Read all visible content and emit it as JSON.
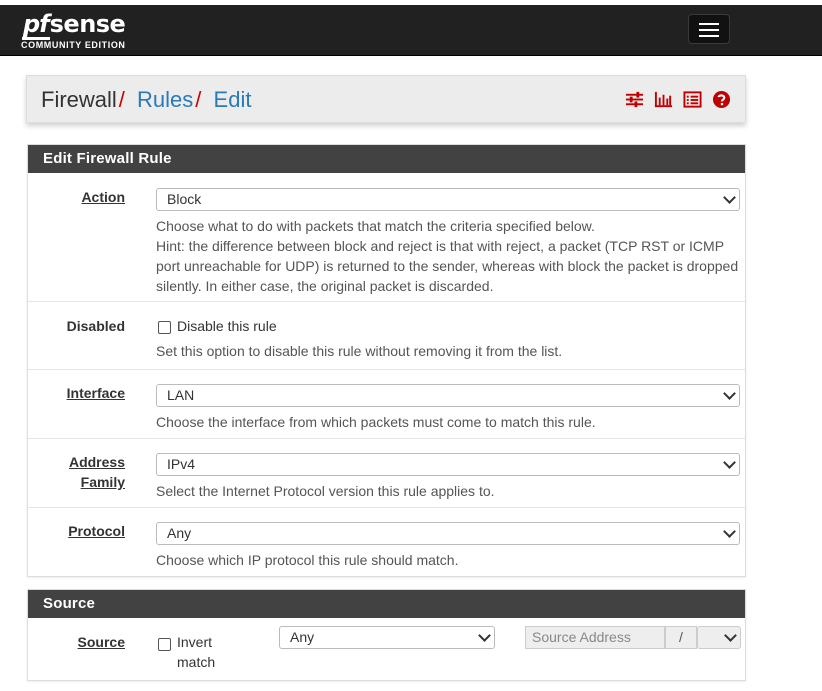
{
  "header": {
    "logo_pf": "pf",
    "logo_sense": "sense",
    "logo_edition": "COMMUNITY EDITION"
  },
  "breadcrumb": {
    "root": "Firewall",
    "sep1": "/",
    "link1": "Rules",
    "sep2": "/",
    "link2": "Edit"
  },
  "breadcrumb_icons": [
    "sliders-icon",
    "bar-chart-icon",
    "list-icon",
    "help-icon"
  ],
  "colors": {
    "navbar": "#212121",
    "panel_header": "#424242",
    "accent_red": "#c00000",
    "link_blue": "#2a7ab8"
  },
  "edit_panel": {
    "title": "Edit Firewall Rule",
    "action": {
      "label": "Action",
      "value": "Block",
      "help1": "Choose what to do with packets that match the criteria specified below.",
      "help2": "Hint: the difference between block and reject is that with reject, a packet (TCP RST or ICMP port unreachable for UDP) is returned to the sender, whereas with block the packet is dropped silently. In either case, the original packet is discarded."
    },
    "disabled": {
      "label": "Disabled",
      "checkbox_label": "Disable this rule",
      "help": "Set this option to disable this rule without removing it from the list."
    },
    "interface": {
      "label": "Interface",
      "value": "LAN",
      "help": "Choose the interface from which packets must come to match this rule."
    },
    "address_family": {
      "label_line1": "Address",
      "label_line2": "Family",
      "value": "IPv4",
      "help": "Select the Internet Protocol version this rule applies to."
    },
    "protocol": {
      "label": "Protocol",
      "value": "Any",
      "help": "Choose which IP protocol this rule should match."
    }
  },
  "source_panel": {
    "title": "Source",
    "label": "Source",
    "invert_line1": "Invert",
    "invert_line2": "match",
    "type_value": "Any",
    "address_placeholder": "Source Address",
    "slash": "/"
  }
}
